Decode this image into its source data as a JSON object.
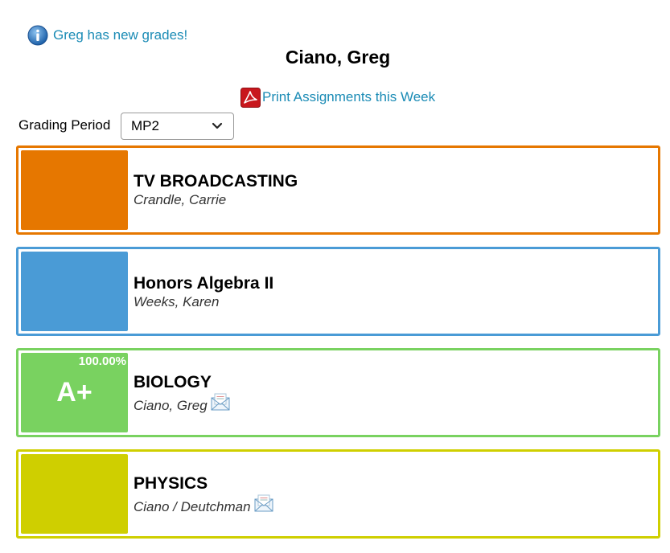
{
  "notice": {
    "text": "Greg has new grades!",
    "icon": "info-icon"
  },
  "student": {
    "name": "Ciano, Greg"
  },
  "print": {
    "label": "Print Assignments this Week",
    "icon": "pdf-icon"
  },
  "grading_period": {
    "label": "Grading Period",
    "selected": "MP2"
  },
  "courses": [
    {
      "name": "TV BROADCASTING",
      "teacher": "Crandle, Carrie",
      "color": "#e67700",
      "grade": "",
      "percent": ""
    },
    {
      "name": "Honors Algebra II",
      "teacher": "Weeks, Karen",
      "color": "#4a9bd6",
      "grade": "",
      "percent": ""
    },
    {
      "name": "BIOLOGY",
      "teacher": "Ciano, Greg",
      "color": "#79d260",
      "grade": "A+",
      "percent": "100.00%",
      "mail_icon": "mail-icon"
    },
    {
      "name": "PHYSICS",
      "teacher": "Ciano / Deutchman",
      "color": "#cfcf00",
      "grade": "",
      "percent": "",
      "mail_icon": "mail-icon"
    }
  ]
}
